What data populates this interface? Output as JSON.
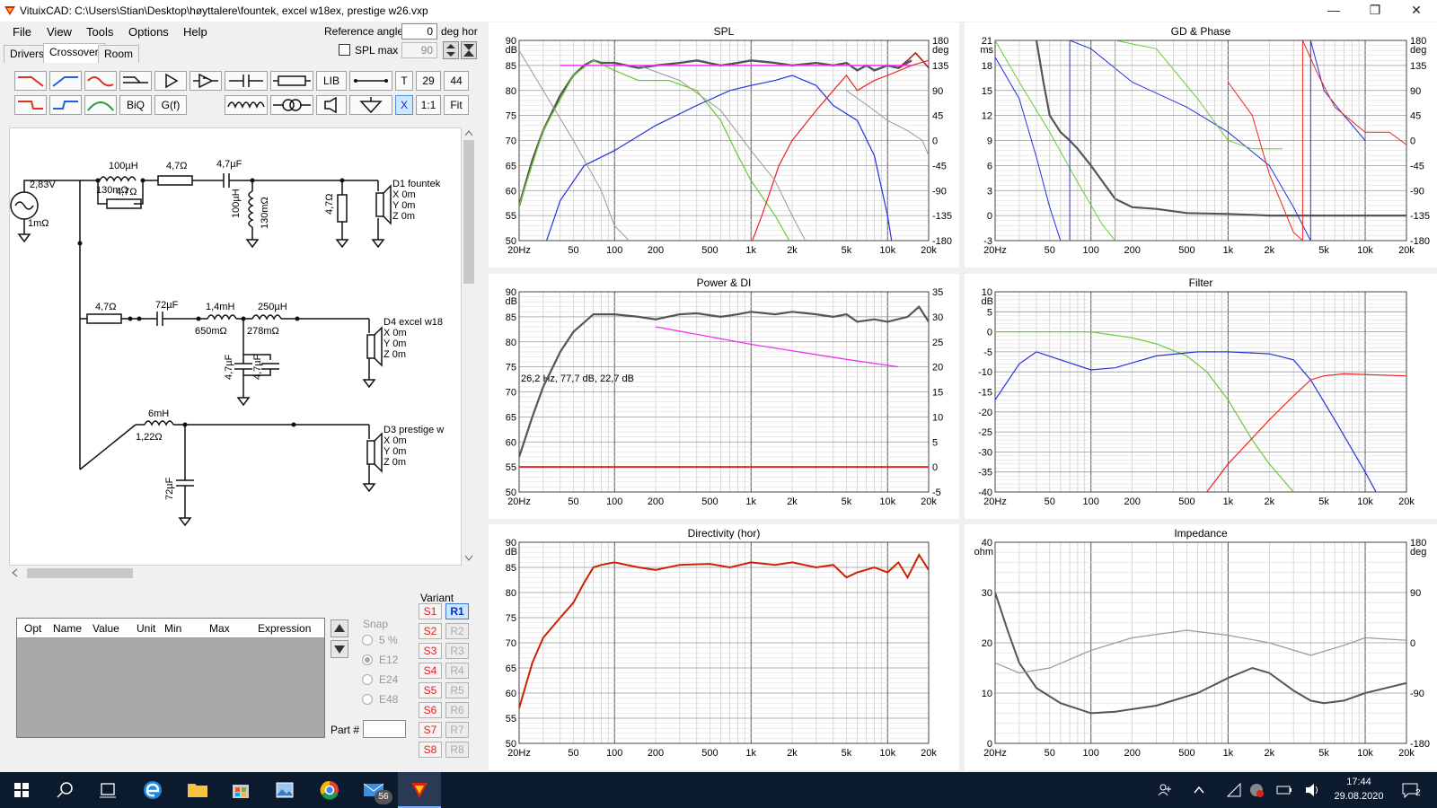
{
  "window": {
    "title": "VituixCAD: C:\\Users\\Stian\\Desktop\\høyttalere\\fountek, excel w18ex, prestige w26.vxp",
    "minimize": "—",
    "maximize": "❐",
    "close": "✕"
  },
  "menu": [
    "File",
    "View",
    "Tools",
    "Options",
    "Help"
  ],
  "reference": {
    "label": "Reference angle",
    "value": "0",
    "unit": "deg hor",
    "spl_max_label": "SPL max",
    "spl_max_value": "90"
  },
  "tabs": [
    "Drivers",
    "Crossover",
    "Room"
  ],
  "toolbar": {
    "biq": "BiQ",
    "gf": "G(f)",
    "lib": "LIB",
    "t": "T",
    "n29": "29",
    "n44": "44",
    "x": "X",
    "ratio": "1:1",
    "fit": "Fit"
  },
  "schematic": {
    "source": {
      "voltage": "2,83V",
      "resistance": "1mΩ"
    },
    "branch1": {
      "l1": "100µH",
      "l1r": "130mΩ",
      "r_par": "4,7Ω",
      "r1": "4,7Ω",
      "c1": "4,7µF",
      "l2": "100µH",
      "l2r": "130mΩ",
      "r2": "4,7Ω",
      "driver": "D1 fountek",
      "x": "X 0m",
      "y": "Y 0m",
      "z": "Z 0m"
    },
    "branch2": {
      "r1": "4,7Ω",
      "c1": "72µF",
      "l1": "1,4mH",
      "l1r": "650mΩ",
      "l2": "250µH",
      "l2r": "278mΩ",
      "c2": "4,7µF",
      "c3": "4,7µF",
      "driver": "D4 excel w18",
      "x": "X 0m",
      "y": "Y 0m",
      "z": "Z 0m"
    },
    "branch3": {
      "l1": "6mH",
      "l1r": "1,22Ω",
      "c1": "72µF",
      "driver": "D3 prestige w",
      "x": "X 0m",
      "y": "Y 0m",
      "z": "Z 0m"
    }
  },
  "optimizer": {
    "columns": [
      "Opt",
      "Name",
      "Value",
      "Unit",
      "Min",
      "Max",
      "Expression"
    ],
    "snap_label": "Snap",
    "snap_options": [
      "5 %",
      "E12",
      "E24",
      "E48"
    ],
    "part_label": "Part #"
  },
  "variant": {
    "label": "Variant",
    "s": [
      "S1",
      "S2",
      "S3",
      "S4",
      "S5",
      "S6",
      "S7",
      "S8"
    ],
    "r": [
      "R1",
      "R2",
      "R3",
      "R4",
      "R5",
      "R6",
      "R7",
      "R8"
    ]
  },
  "colors": {
    "gray_curve": "#555555",
    "green": "#66cc33",
    "blue": "#2233dd",
    "red": "#ee2222",
    "magenta": "#ee33ee",
    "directivity": "#cc2200",
    "grid": "#b0b0b0"
  },
  "x_ticks": [
    "20Hz",
    "50",
    "100",
    "200",
    "500",
    "1k",
    "2k",
    "5k",
    "10k",
    "20k"
  ],
  "chart_data": [
    {
      "type": "line",
      "title": "SPL",
      "ylabel": "dB",
      "y2label": "deg",
      "yticks": [
        "90",
        "85",
        "80",
        "75",
        "70",
        "65",
        "60",
        "55",
        "50"
      ],
      "y2ticks": [
        "180",
        "135",
        "90",
        "45",
        "0",
        "-45",
        "-90",
        "-135",
        "-180"
      ],
      "ylim": [
        50,
        90
      ],
      "xscale": "log",
      "xlim": [
        20,
        20000
      ]
    },
    {
      "type": "line",
      "title": "GD & Phase",
      "ylabel": "ms",
      "y2label": "deg",
      "yticks": [
        "21",
        "18",
        "15",
        "12",
        "9",
        "6",
        "3",
        "0",
        "-3"
      ],
      "y2ticks": [
        "180",
        "135",
        "90",
        "45",
        "0",
        "-45",
        "-90",
        "-135",
        "-180"
      ],
      "ylim": [
        -3,
        21
      ],
      "xscale": "log",
      "xlim": [
        20,
        20000
      ]
    },
    {
      "type": "line",
      "title": "Power & DI",
      "ylabel": "dB",
      "yticks": [
        "90",
        "85",
        "80",
        "75",
        "70",
        "65",
        "60",
        "55",
        "50"
      ],
      "y2ticks": [
        "35",
        "30",
        "25",
        "20",
        "15",
        "10",
        "5",
        "0",
        "-5"
      ],
      "ylim": [
        50,
        90
      ],
      "xscale": "log",
      "xlim": [
        20,
        20000
      ],
      "annotation": "26,2 Hz, 77,7 dB, 22,7 dB"
    },
    {
      "type": "line",
      "title": "Filter",
      "ylabel": "dB",
      "yticks": [
        "10",
        "5",
        "0",
        "-5",
        "-10",
        "-15",
        "-20",
        "-25",
        "-30",
        "-35",
        "-40"
      ],
      "ylim": [
        -40,
        10
      ],
      "xscale": "log",
      "xlim": [
        20,
        20000
      ]
    },
    {
      "type": "line",
      "title": "Directivity (hor)",
      "ylabel": "dB",
      "yticks": [
        "90",
        "85",
        "80",
        "75",
        "70",
        "65",
        "60",
        "55",
        "50"
      ],
      "ylim": [
        50,
        90
      ],
      "xscale": "log",
      "xlim": [
        20,
        20000
      ]
    },
    {
      "type": "line",
      "title": "Impedance",
      "ylabel": "ohm",
      "y2label": "deg",
      "yticks": [
        "40",
        "30",
        "20",
        "10",
        "0"
      ],
      "y2ticks": [
        "180",
        "90",
        "0",
        "-90",
        "-180"
      ],
      "ylim": [
        0,
        40
      ],
      "xscale": "log",
      "xlim": [
        20,
        20000
      ]
    }
  ],
  "taskbar": {
    "mail_badge": "56",
    "time": "17:44",
    "date": "29.08.2020",
    "notif_count": "2"
  }
}
